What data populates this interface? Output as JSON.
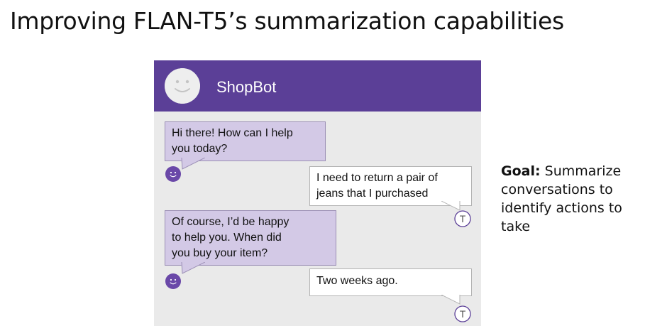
{
  "slide": {
    "title": "Improving FLAN-T5’s summarization capabilities"
  },
  "chat": {
    "bot_name": "ShopBot",
    "header_color": "#5b3f97",
    "user_avatar_letter": "T",
    "messages": [
      {
        "sender": "bot",
        "lines": [
          "Hi there! How can I help",
          "you today?"
        ]
      },
      {
        "sender": "user",
        "lines": [
          "I need to return a pair of",
          "jeans that I purchased"
        ]
      },
      {
        "sender": "bot",
        "lines": [
          "Of course, I’d be happy",
          "to help you. When did",
          "you buy your item?"
        ]
      },
      {
        "sender": "user",
        "lines": [
          "Two weeks ago."
        ]
      }
    ]
  },
  "goal": {
    "label": "Goal:",
    "text": "Summarize conversations to identify actions to take"
  }
}
